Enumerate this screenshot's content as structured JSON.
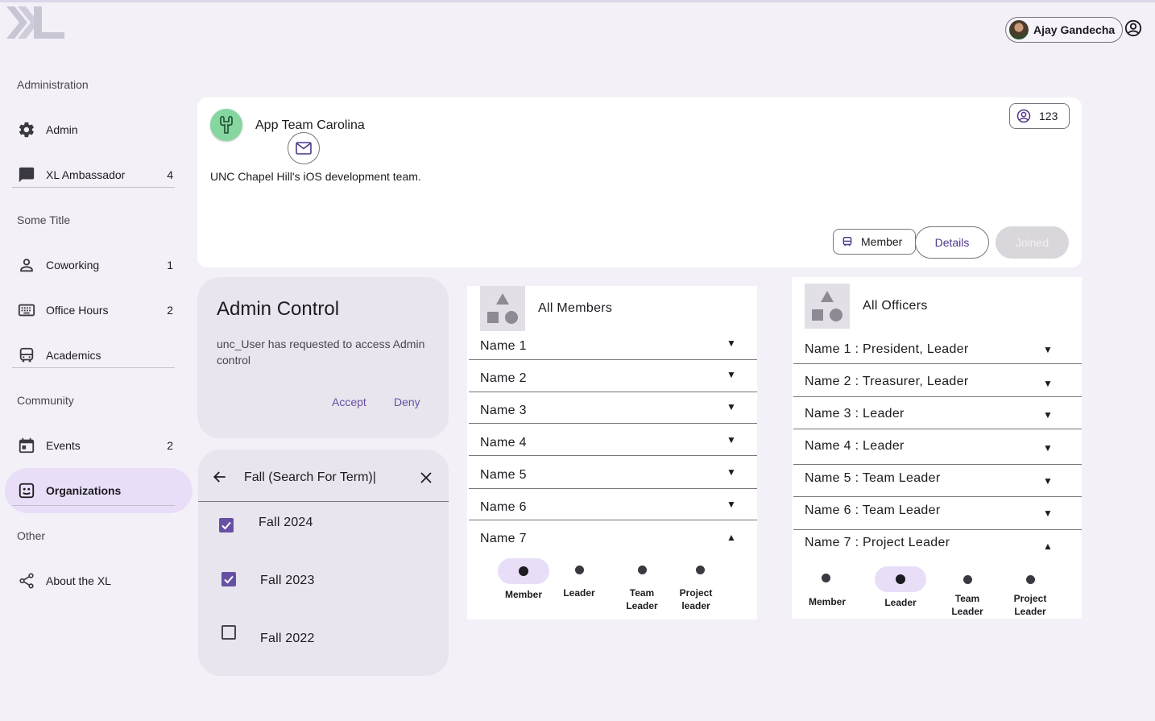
{
  "user": {
    "name": "Ajay Gandecha"
  },
  "sidebar": {
    "sections": [
      {
        "title": "Administration"
      },
      {
        "title": "Some Title"
      },
      {
        "title": "Community"
      },
      {
        "title": "Other"
      }
    ],
    "items": [
      {
        "label": "Admin",
        "count": "",
        "icon": "gear-icon"
      },
      {
        "label": "XL Ambassador",
        "count": "4",
        "icon": "chat-icon"
      },
      {
        "label": "Coworking",
        "count": "1",
        "icon": "person-icon"
      },
      {
        "label": "Office Hours",
        "count": "2",
        "icon": "keyboard-icon"
      },
      {
        "label": "Academics",
        "count": "",
        "icon": "bus-icon"
      },
      {
        "label": "Events",
        "count": "2",
        "icon": "calendar-icon"
      },
      {
        "label": "Organizations",
        "count": "",
        "icon": "badge-icon"
      },
      {
        "label": "About the XL",
        "count": "",
        "icon": "share-icon"
      }
    ]
  },
  "org": {
    "name": "App Team Carolina",
    "description": "UNC Chapel Hill's iOS development team.",
    "member_count": "123",
    "member_label": "Member",
    "details_label": "Details",
    "joined_label": "Joined"
  },
  "admin_control": {
    "title": "Admin Control",
    "message": "unc_User has requested to access Admin control",
    "accept_label": "Accept",
    "deny_label": "Deny"
  },
  "term_search": {
    "query": "Fall (Search For Term)",
    "options": [
      {
        "label": "Fall 2024",
        "checked": true
      },
      {
        "label": "Fall 2023",
        "checked": true
      },
      {
        "label": "Fall 2022",
        "checked": false
      }
    ]
  },
  "members": {
    "title": "All Members",
    "rows": [
      "Name 1",
      "Name 2",
      "Name 3",
      "Name 4",
      "Name 5",
      "Name 6",
      "Name 7"
    ],
    "roles": [
      "Member",
      "Leader",
      "Team Leader",
      "Project leader"
    ],
    "selected_role": "Member"
  },
  "officers": {
    "title": "All Officers",
    "rows": [
      "Name 1 : President, Leader",
      "Name 2 : Treasurer, Leader",
      "Name 3 : Leader",
      "Name 4 : Leader",
      "Name 5 : Team Leader",
      "Name 6 : Team Leader",
      "Name 7 :  Project Leader"
    ],
    "roles": [
      "Member",
      "Leader",
      "Team Leader",
      "Project Leader"
    ],
    "selected_role": "Leader"
  },
  "colors": {
    "accent": "#6750a4",
    "selected_bg": "#e8def8",
    "background": "#f4f0f7"
  }
}
